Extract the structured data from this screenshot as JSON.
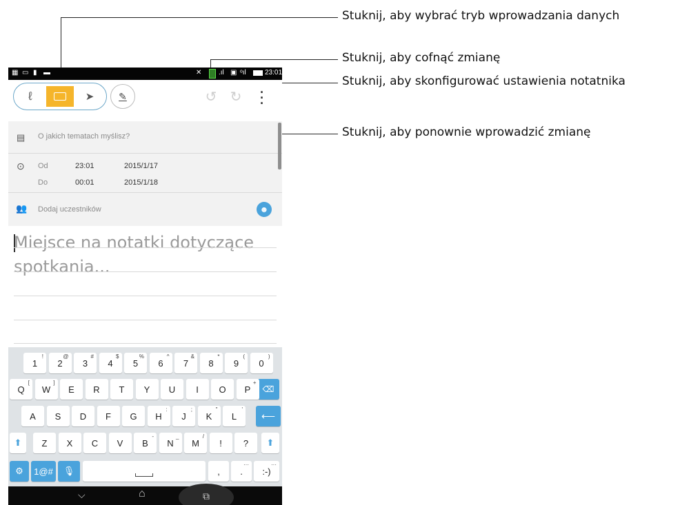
{
  "callouts": [
    "Stuknij, aby wybrać tryb wprowadzania danych",
    "Stuknij, aby cofnąć zmianę",
    "Stuknij, aby skonfigurować ustawienia notatnika",
    "Stuknij, aby ponownie wprowadzić zmianę"
  ],
  "status": {
    "time": "23:01"
  },
  "form": {
    "subject_placeholder": "O jakich tematach myślisz?",
    "from_label": "Od",
    "from_time": "23:01",
    "from_date": "2015/1/17",
    "to_label": "Do",
    "to_time": "00:01",
    "to_date": "2015/1/18",
    "participants_placeholder": "Dodaj uczestników"
  },
  "notes": {
    "placeholder_line1": "Miejsce na notatki dotyczące",
    "placeholder_line2": "spotkania..."
  },
  "keyboard": {
    "row1": [
      {
        "k": "1",
        "s": "!"
      },
      {
        "k": "2",
        "s": "@"
      },
      {
        "k": "3",
        "s": "#"
      },
      {
        "k": "4",
        "s": "$"
      },
      {
        "k": "5",
        "s": "%"
      },
      {
        "k": "6",
        "s": "^"
      },
      {
        "k": "7",
        "s": "&"
      },
      {
        "k": "8",
        "s": "*"
      },
      {
        "k": "9",
        "s": "("
      },
      {
        "k": "0",
        "s": ")"
      }
    ],
    "row2": [
      {
        "k": "Q",
        "s": "["
      },
      {
        "k": "W",
        "s": "]"
      },
      {
        "k": "E",
        "s": ""
      },
      {
        "k": "R",
        "s": ""
      },
      {
        "k": "T",
        "s": ""
      },
      {
        "k": "Y",
        "s": ""
      },
      {
        "k": "U",
        "s": ""
      },
      {
        "k": "I",
        "s": ""
      },
      {
        "k": "O",
        "s": ""
      },
      {
        "k": "P",
        "s": "+"
      }
    ],
    "row3": [
      {
        "k": "A",
        "s": ""
      },
      {
        "k": "S",
        "s": ""
      },
      {
        "k": "D",
        "s": ""
      },
      {
        "k": "F",
        "s": ""
      },
      {
        "k": "G",
        "s": ""
      },
      {
        "k": "H",
        "s": ":"
      },
      {
        "k": "J",
        "s": ";"
      },
      {
        "k": "K",
        "s": "\""
      },
      {
        "k": "L",
        "s": "'"
      }
    ],
    "row4": [
      {
        "k": "Z",
        "s": ""
      },
      {
        "k": "X",
        "s": ""
      },
      {
        "k": "C",
        "s": ""
      },
      {
        "k": "V",
        "s": ""
      },
      {
        "k": "B",
        "s": "-"
      },
      {
        "k": "N",
        "s": "_"
      },
      {
        "k": "M",
        "s": "/"
      },
      {
        "k": "!",
        "s": ""
      },
      {
        "k": "?",
        "s": ""
      }
    ],
    "symbols_label": "1@#",
    "comma": ",",
    "period": ".",
    "smiley": ":-)"
  },
  "colors": {
    "accent": "#f5b52b",
    "key_blue": "#4aa3dc",
    "outline": "#6aa6c8"
  }
}
